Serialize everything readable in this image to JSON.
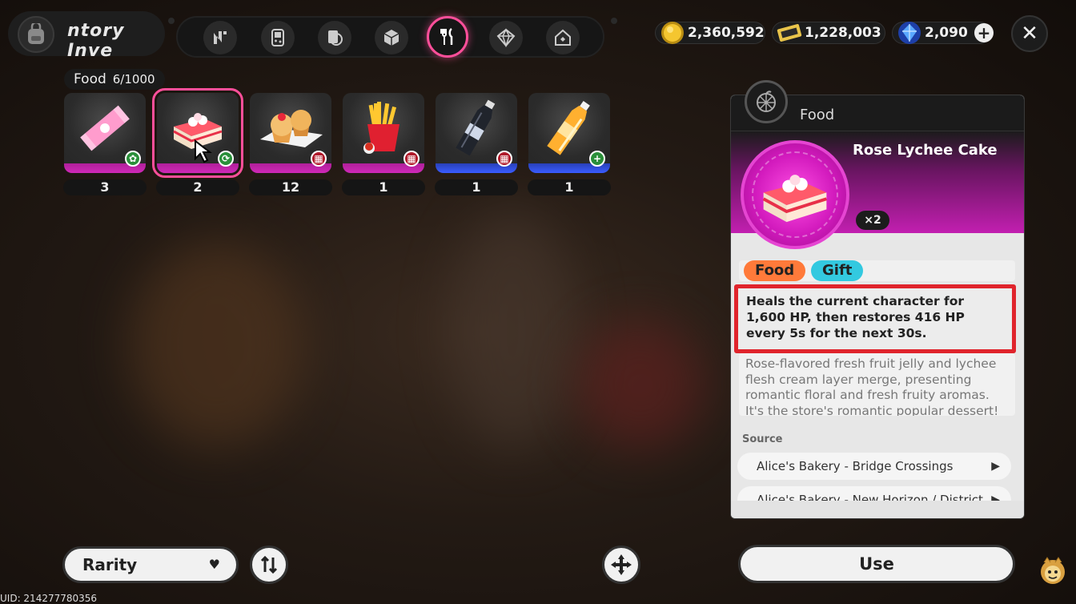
{
  "header": {
    "title": "ntory Inve"
  },
  "categories": [
    {
      "name": "nav-tab-n",
      "icon": "n-logo-icon"
    },
    {
      "name": "nav-tab-device",
      "icon": "handheld-icon"
    },
    {
      "name": "nav-tab-disc",
      "icon": "disc-icon"
    },
    {
      "name": "nav-tab-box",
      "icon": "box-icon"
    },
    {
      "name": "nav-tab-food",
      "icon": "fork-knife-icon",
      "active": true
    },
    {
      "name": "nav-tab-gem",
      "icon": "gem-icon"
    },
    {
      "name": "nav-tab-home",
      "icon": "house-icon"
    }
  ],
  "currencies": [
    {
      "icon": "coin-icon",
      "value": "2,360,592"
    },
    {
      "icon": "ticket-icon",
      "value": "1,228,003"
    },
    {
      "icon": "crystal-icon",
      "value": "2,090"
    }
  ],
  "inventory": {
    "label": "Food",
    "count": "6/1000",
    "items": [
      {
        "name": "candy-bar",
        "qty": "3",
        "rarity": "pink",
        "badge": "green"
      },
      {
        "name": "rose-lychee-cake",
        "qty": "2",
        "rarity": "pink",
        "badge": "green",
        "selected": true
      },
      {
        "name": "muffins",
        "qty": "12",
        "rarity": "pink",
        "badge": "red"
      },
      {
        "name": "french-fries",
        "qty": "1",
        "rarity": "pink",
        "badge": "red"
      },
      {
        "name": "cola-bottle",
        "qty": "1",
        "rarity": "blue",
        "badge": "red"
      },
      {
        "name": "orange-juice",
        "qty": "1",
        "rarity": "blue",
        "badge": "green"
      }
    ]
  },
  "detail": {
    "category": "Food",
    "name": "Rose Lychee Cake",
    "quantity": "×2",
    "tags": [
      "Food",
      "Gift"
    ],
    "effect": "Heals the current character for 1,600 HP, then restores 416 HP every 5s for the next 30s.",
    "description": "Rose-flavored fresh fruit jelly and lychee flesh cream layer merge, presenting romantic floral and fresh fruity aromas. It's the store's romantic popular dessert!",
    "source_label": "Source",
    "sources": [
      "Alice's Bakery - Bridge Crossings",
      "Alice's Bakery - New Horizon / District"
    ]
  },
  "controls": {
    "sort": "Rarity",
    "use": "Use"
  },
  "footer": {
    "uid": "UID: 214277780356"
  },
  "colors": {
    "accent": "#ff4f9a",
    "rarity_pink": "#c21fb0",
    "rarity_blue": "#3a5cff",
    "highlight_box": "#e0242c"
  }
}
